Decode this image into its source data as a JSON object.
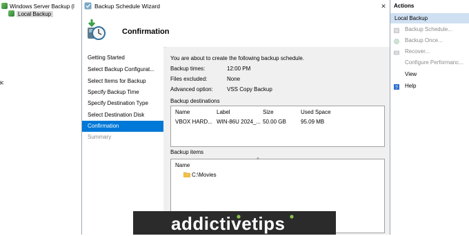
{
  "tree": {
    "root_label": "Windows Server Backup (l",
    "selected_label": "Local Backup"
  },
  "dialog": {
    "title": "Backup Schedule Wizard",
    "close_glyph": "✕",
    "heading": "Confirmation",
    "nav": [
      {
        "label": "Getting Started",
        "state": "normal"
      },
      {
        "label": "Select Backup Configurat...",
        "state": "normal"
      },
      {
        "label": "Select Items for Backup",
        "state": "normal"
      },
      {
        "label": "Specify Backup Time",
        "state": "normal"
      },
      {
        "label": "Specify Destination Type",
        "state": "normal"
      },
      {
        "label": "Select Destination Disk",
        "state": "normal"
      },
      {
        "label": "Confirmation",
        "state": "active"
      },
      {
        "label": "Summary",
        "state": "disabled"
      }
    ],
    "intro": "You are about to create the following backup schedule.",
    "details": {
      "times_label": "Backup times:",
      "times_value": "12:00 PM",
      "excluded_label": "Files excluded:",
      "excluded_value": "None",
      "option_label": "Advanced option:",
      "option_value": "VSS Copy Backup"
    },
    "destinations": {
      "group_label": "Backup destinations",
      "columns": [
        "Name",
        "Label",
        "Size",
        "Used Space"
      ],
      "rows": [
        [
          "VBOX HARD...",
          "WIN-86U 2024_...",
          "50.00 GB",
          "95.09 MB"
        ]
      ]
    },
    "items": {
      "group_label": "Backup items",
      "column": "Name",
      "entries": [
        "C:\\Movies"
      ],
      "collapse_glyph": "^"
    }
  },
  "actions": {
    "header": "Actions",
    "selected": "Local Backup",
    "items": [
      {
        "label": "Backup Schedule...",
        "state": "disabled",
        "icon": "calendar-icon"
      },
      {
        "label": "Backup Once...",
        "state": "disabled",
        "icon": "backup-once-icon"
      },
      {
        "label": "Recover...",
        "state": "disabled",
        "icon": "recover-icon"
      },
      {
        "label": "Configure Performanc...",
        "state": "disabled",
        "icon": "none"
      },
      {
        "label": "View",
        "state": "normal",
        "icon": "none"
      },
      {
        "label": "Help",
        "state": "normal",
        "icon": "help-icon"
      }
    ]
  },
  "watermark": {
    "text": "addictivetips",
    "colors": {
      "bg": "#2b2b2b",
      "text": "#ffffff",
      "accent": "#8bc34a"
    }
  }
}
